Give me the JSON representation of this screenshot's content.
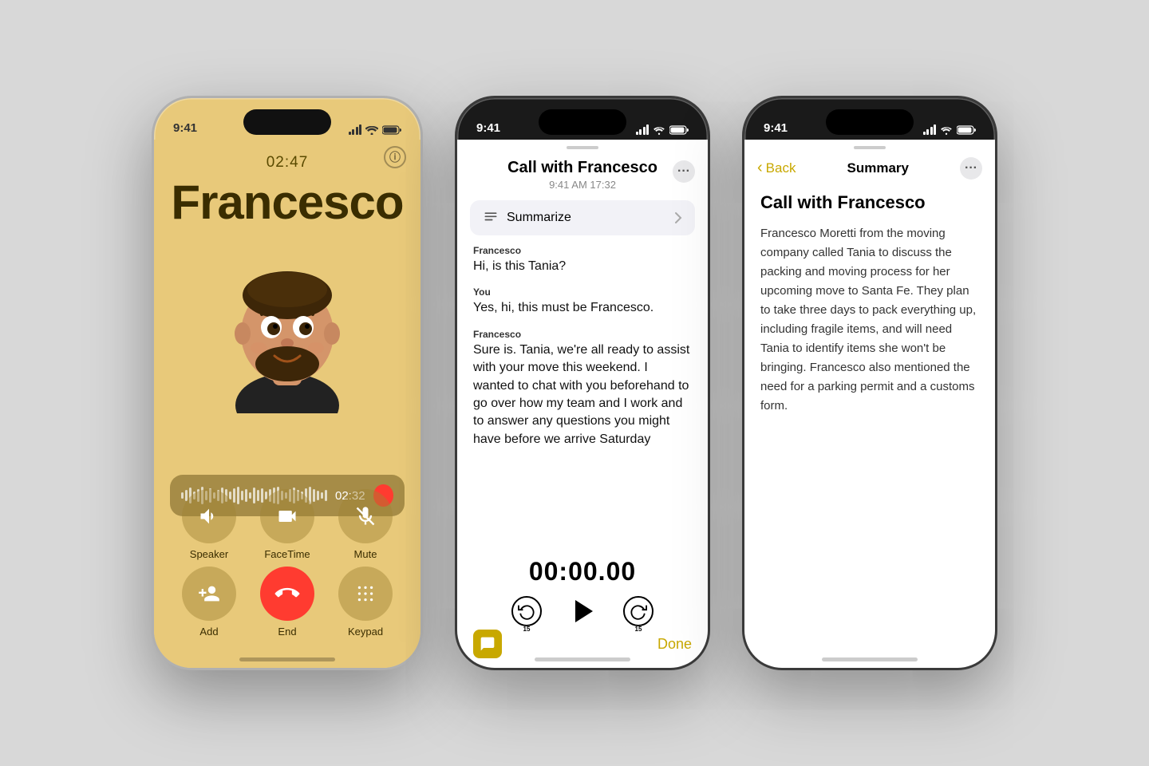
{
  "bg_color": "#d8d8d8",
  "phone1": {
    "status_time": "9:41",
    "call_duration": "02:47",
    "caller_name": "Francesco",
    "recording_time": "02:32",
    "buttons": [
      {
        "id": "speaker",
        "label": "Speaker",
        "icon": "🔊"
      },
      {
        "id": "facetime",
        "label": "FaceTime",
        "icon": "📹"
      },
      {
        "id": "mute",
        "label": "Mute",
        "icon": "🎙"
      },
      {
        "id": "add",
        "label": "Add",
        "icon": "👤+"
      },
      {
        "id": "end",
        "label": "End",
        "icon": "📞"
      },
      {
        "id": "keypad",
        "label": "Keypad",
        "icon": "⠿"
      }
    ]
  },
  "phone2": {
    "status_time": "9:41",
    "title": "Call with Francesco",
    "subtitle": "9:41 AM  17:32",
    "more_icon": "•••",
    "summarize_label": "Summarize",
    "transcript": [
      {
        "speaker": "Francesco",
        "text": "Hi, is this Tania?"
      },
      {
        "speaker": "You",
        "text": "Yes, hi, this must be Francesco."
      },
      {
        "speaker": "Francesco",
        "text": "Sure is. Tania, we're all ready to assist with your move this weekend. I wanted to chat with you beforehand to go over how my team and I work and to answer any questions you might have before we arrive Saturday"
      }
    ],
    "timer": "00:00.00",
    "skip_back_label": "15",
    "skip_fwd_label": "15",
    "done_label": "Done",
    "chat_icon": "💬"
  },
  "phone3": {
    "status_time": "9:41",
    "back_label": "Back",
    "nav_title": "Summary",
    "more_icon": "•••",
    "title": "Call with Francesco",
    "summary": "Francesco Moretti from the moving company called Tania to discuss the packing and moving process for her upcoming move to Santa Fe. They plan to take three days to pack everything up, including fragile items, and will need Tania to identify items she won't be bringing. Francesco also mentioned the need for a parking permit and a customs form."
  }
}
